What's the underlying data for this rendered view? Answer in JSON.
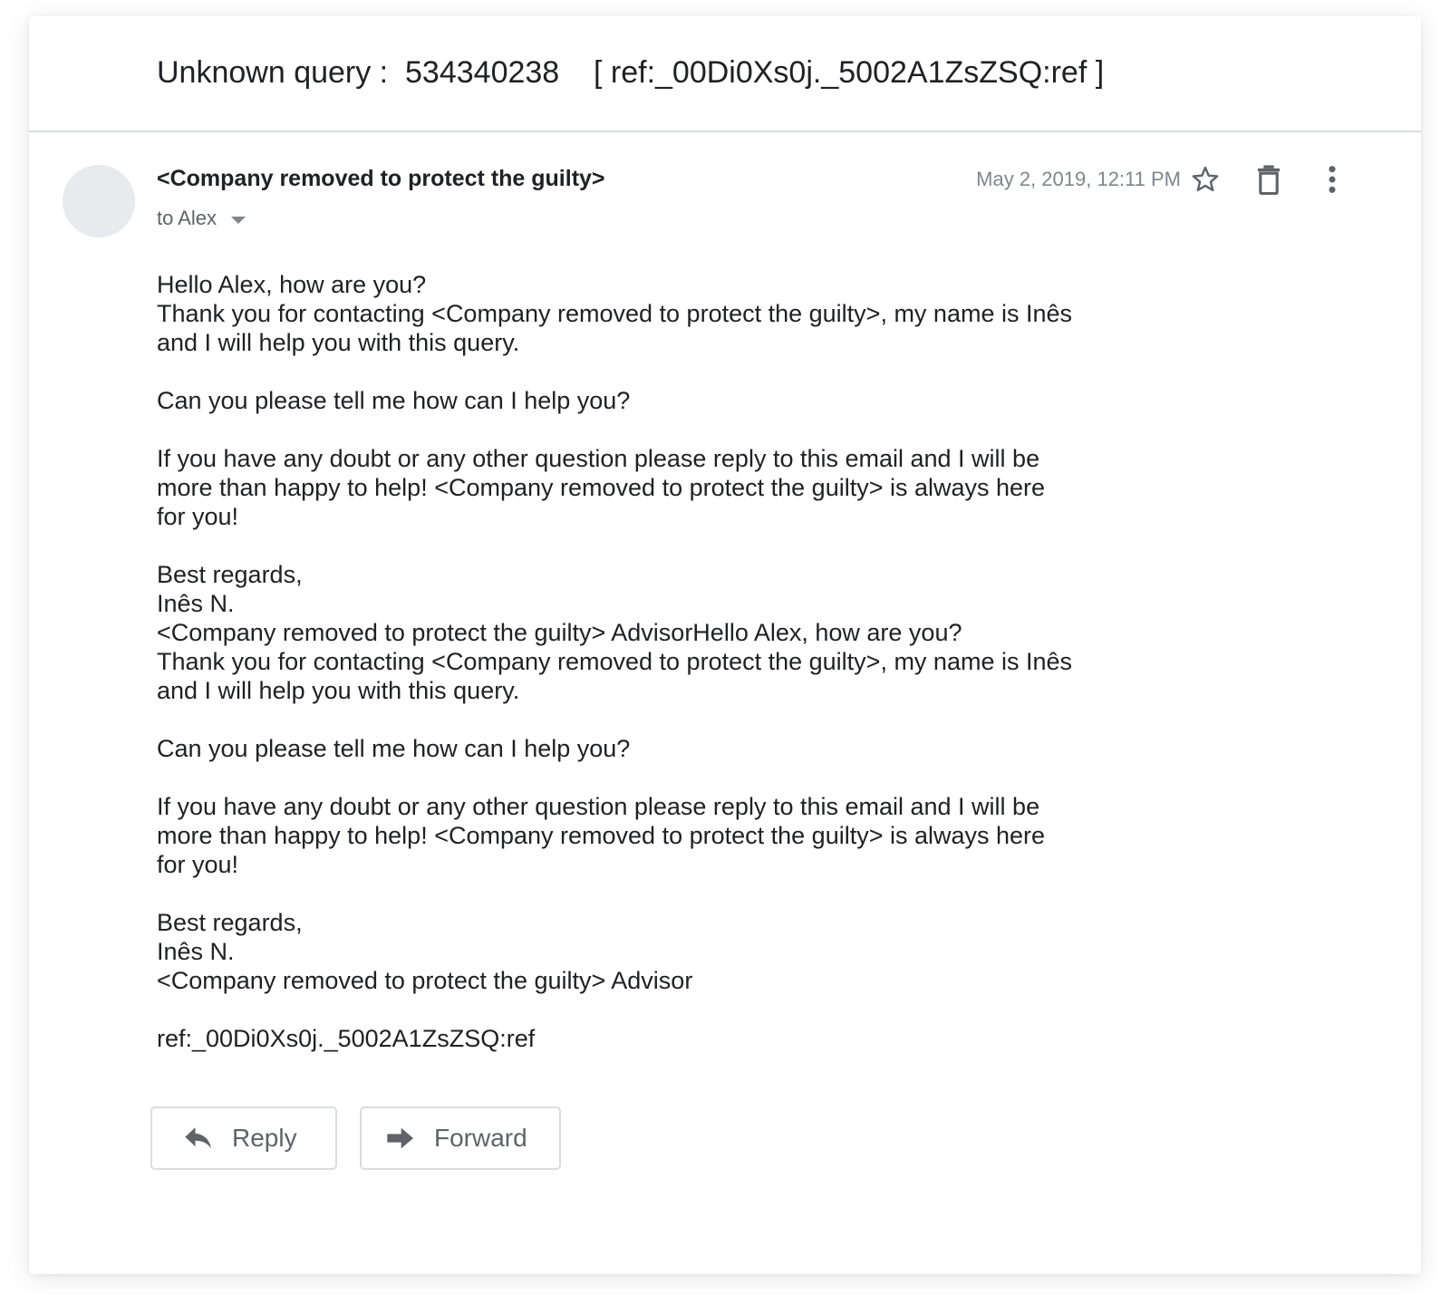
{
  "email": {
    "subject": "Unknown query :  534340238    [ ref:_00Di0Xs0j._5002A1ZsZSQ:ref ]",
    "sender": "<Company removed to protect the guilty>",
    "recipient": "to Alex",
    "timestamp": "May 2, 2019, 12:11 PM",
    "icons": {
      "star": "star-icon",
      "trash": "trash-icon",
      "more": "more-vert-icon",
      "recipient_details": "chevron-down-icon",
      "reply": "reply-icon",
      "forward": "forward-icon"
    },
    "body": [
      [
        "Hello Alex, how are you?",
        "Thank you for contacting <Company removed to protect the guilty>, my name is Inês",
        "and I will help you with this query."
      ],
      [
        "Can you please tell me how can I help you?"
      ],
      [
        "If you have any doubt or any other question please reply to this email and I will be",
        "more than happy to help! <Company removed to protect the guilty> is always here",
        "for you!"
      ],
      [
        "Best regards,",
        "Inês N.",
        "<Company removed to protect the guilty> AdvisorHello Alex, how are you?",
        "Thank you for contacting <Company removed to protect the guilty>, my name is Inês",
        "and I will help you with this query."
      ],
      [
        "Can you please tell me how can I help you?"
      ],
      [
        "If you have any doubt or any other question please reply to this email and I will be",
        "more than happy to help! <Company removed to protect the guilty> is always here",
        "for you!"
      ],
      [
        "Best regards,",
        "Inês N.",
        "<Company removed to protect the guilty> Advisor"
      ],
      [
        "ref:_00Di0Xs0j._5002A1ZsZSQ:ref"
      ]
    ]
  },
  "actions": {
    "reply_label": "Reply",
    "forward_label": "Forward"
  },
  "colors": {
    "text": "#202124",
    "secondary_text": "#5f6368",
    "muted": "#80868b",
    "divider": "#dadce0",
    "avatar": "#e8eaed"
  }
}
